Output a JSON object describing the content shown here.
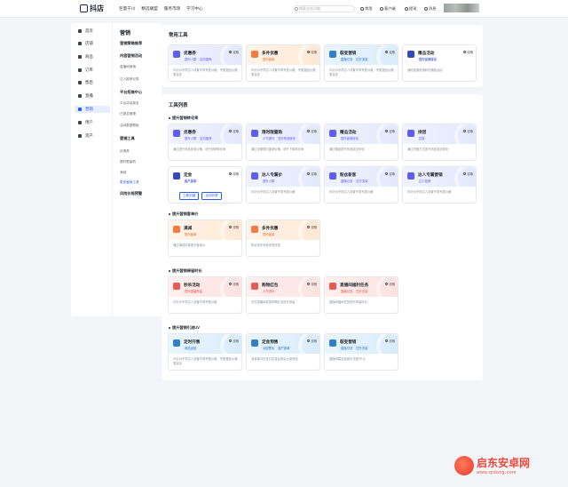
{
  "topbar": {
    "logo": "抖店",
    "nav": [
      "巨量千川",
      "精选联盟",
      "服务市场",
      "学习中心"
    ],
    "search_placeholder": "搜索全站功能",
    "links": [
      "常用",
      "客户端",
      "提现",
      "消息"
    ]
  },
  "sidebar": {
    "items": [
      "首页",
      "店铺",
      "商品",
      "订单",
      "售后",
      "直播",
      "营销",
      "用户",
      "资产"
    ],
    "active": "营销",
    "sub_title": "营销",
    "sub": [
      {
        "type": "h",
        "label": "营销策略推荐"
      },
      {
        "type": "h",
        "label": "内容营销活动"
      },
      {
        "type": "i",
        "label": "直播间营销"
      },
      {
        "type": "i",
        "label": "达人推荐记录"
      },
      {
        "type": "h",
        "label": "平台招商中心"
      },
      {
        "type": "i",
        "label": "平台活动报名"
      },
      {
        "type": "i",
        "label": "已报名管理"
      },
      {
        "type": "i",
        "label": "活动数据看板"
      },
      {
        "type": "h",
        "label": "营销工具"
      },
      {
        "type": "i",
        "label": "优惠券"
      },
      {
        "type": "i",
        "label": "限时限量购"
      },
      {
        "type": "i",
        "label": "满减"
      },
      {
        "type": "i",
        "label": "更多营销工具",
        "active": true
      },
      {
        "type": "h",
        "label": "风险价格预警"
      }
    ]
  },
  "common_tools": {
    "title": "常用工具",
    "cards": [
      {
        "name": "优惠券",
        "tags": [
          "提升人群",
          "定向推荐"
        ],
        "desc": "可针对不同达人设置不同专属价格，专属推品价格更高效",
        "theme": "blue",
        "icon": "ticket-icon"
      },
      {
        "name": "多件优惠",
        "tags": [
          "提升客单"
        ],
        "desc": "可针对不同达人设置不同专属价格，专属推品价格更高效",
        "theme": "orange",
        "icon": "tag-icon"
      },
      {
        "name": "裂变营销",
        "tags": [
          "直播引流",
          "拉升流量"
        ],
        "desc": "可针对不同达人设置不同专属价格，专属推品价格更高效",
        "theme": "teal",
        "icon": "share-icon"
      },
      {
        "name": "赠品活动",
        "tags": [
          "提升促销转化"
        ],
        "desc": "通用促销营销转化赠品活动",
        "theme": "white",
        "icon": "gift-icon"
      }
    ]
  },
  "tool_list": {
    "title": "工具列表",
    "guide_label": "攻略",
    "groups": [
      {
        "title": "提升营销转化率",
        "cards": [
          {
            "name": "优惠券",
            "tags": [
              "提升人群",
              "定向推荐"
            ],
            "desc": "通过提升商品优惠价格，提升营销转化率",
            "theme": "blue",
            "icon": "ticket-icon"
          },
          {
            "name": "限时限量购",
            "tags": [
              "人气提升",
              "提升商品转化"
            ],
            "desc": "通过设置限时促销价格，提升下单转化率",
            "theme": "blue",
            "icon": "clock-icon"
          },
          {
            "name": "赠品活动",
            "tags": [
              "提升促销转化"
            ],
            "desc": "通过赠品提升商品成交转化",
            "theme": "blue",
            "icon": "gift-icon"
          },
          {
            "name": "拼团",
            "tags": [
              "拉新"
            ],
            "desc": "通过拼团方式提升商品成交转化",
            "theme": "blue",
            "icon": "group-icon"
          },
          {
            "name": "定金",
            "tags": [
              "客户锁单"
            ],
            "desc": "",
            "theme": "white",
            "icon": "pin-icon",
            "buttons": [
              "立即创建",
              "活动列表"
            ]
          },
          {
            "name": "达人专属价",
            "tags": [
              "提升人群"
            ],
            "desc": "可针对不同达人设置不同专属价格",
            "theme": "blue",
            "icon": "diamond-icon"
          },
          {
            "name": "粉丝新客",
            "tags": [
              "直播引流",
              "拉升流量"
            ],
            "desc": "可针对不同达人设置不同专属价格",
            "theme": "blue",
            "icon": "heart-icon"
          },
          {
            "name": "达人专属营销",
            "tags": [
              "达人营销"
            ],
            "desc": "可针对不同达人设置不同专属价格",
            "theme": "blue",
            "icon": "flag-icon"
          }
        ]
      },
      {
        "title": "提升营销客单价",
        "cards": [
          {
            "name": "满减",
            "tags": [
              "提升客单"
            ],
            "desc": "通过满减设置提升客单价",
            "theme": "orange",
            "icon": "tag-icon"
          },
          {
            "name": "多件优惠",
            "tags": [
              "提升客单"
            ],
            "desc": "购买多件商品享受优惠",
            "theme": "orange",
            "icon": "tag-icon"
          }
        ]
      },
      {
        "title": "提升营销停留时长",
        "cards": [
          {
            "name": "秒杀活动",
            "tags": [
              "提升直播停留"
            ],
            "desc": "可针对不同达人设置不同专属价格",
            "theme": "red",
            "icon": "bolt-icon"
          },
          {
            "name": "购物红包",
            "tags": [
              "人气提升"
            ],
            "desc": "可在直播间发放购物红包提升停留",
            "theme": "red",
            "icon": "envelope-icon"
          },
          {
            "name": "直播间福利任务",
            "tags": [
              "直播引流",
              "拉升流量"
            ],
            "desc": "直播间福利任务提升停留时长",
            "theme": "red",
            "icon": "gift-icon"
          }
        ]
      },
      {
        "title": "提升营销引流UV",
        "cards": [
          {
            "name": "定时开售",
            "tags": [
              "商品运营"
            ],
            "desc": "可针对不同达人设置不同专属价格，专属推品价格更高效",
            "theme": "teal",
            "icon": "clock-icon"
          },
          {
            "name": "定金预售",
            "tags": [
              "大促蓄水",
              "客户锁单"
            ],
            "desc": "消费者可在支付定金后购买大促商品",
            "theme": "teal",
            "icon": "lock-icon"
          },
          {
            "name": "裂变营销",
            "tags": [
              "直播引流",
              "拉升流量"
            ],
            "desc": "直播间裂变营销引流提升UV",
            "theme": "teal",
            "icon": "share-icon"
          }
        ]
      }
    ]
  },
  "watermark": {
    "title": "启东安卓网",
    "url": "www.qidong.com"
  }
}
